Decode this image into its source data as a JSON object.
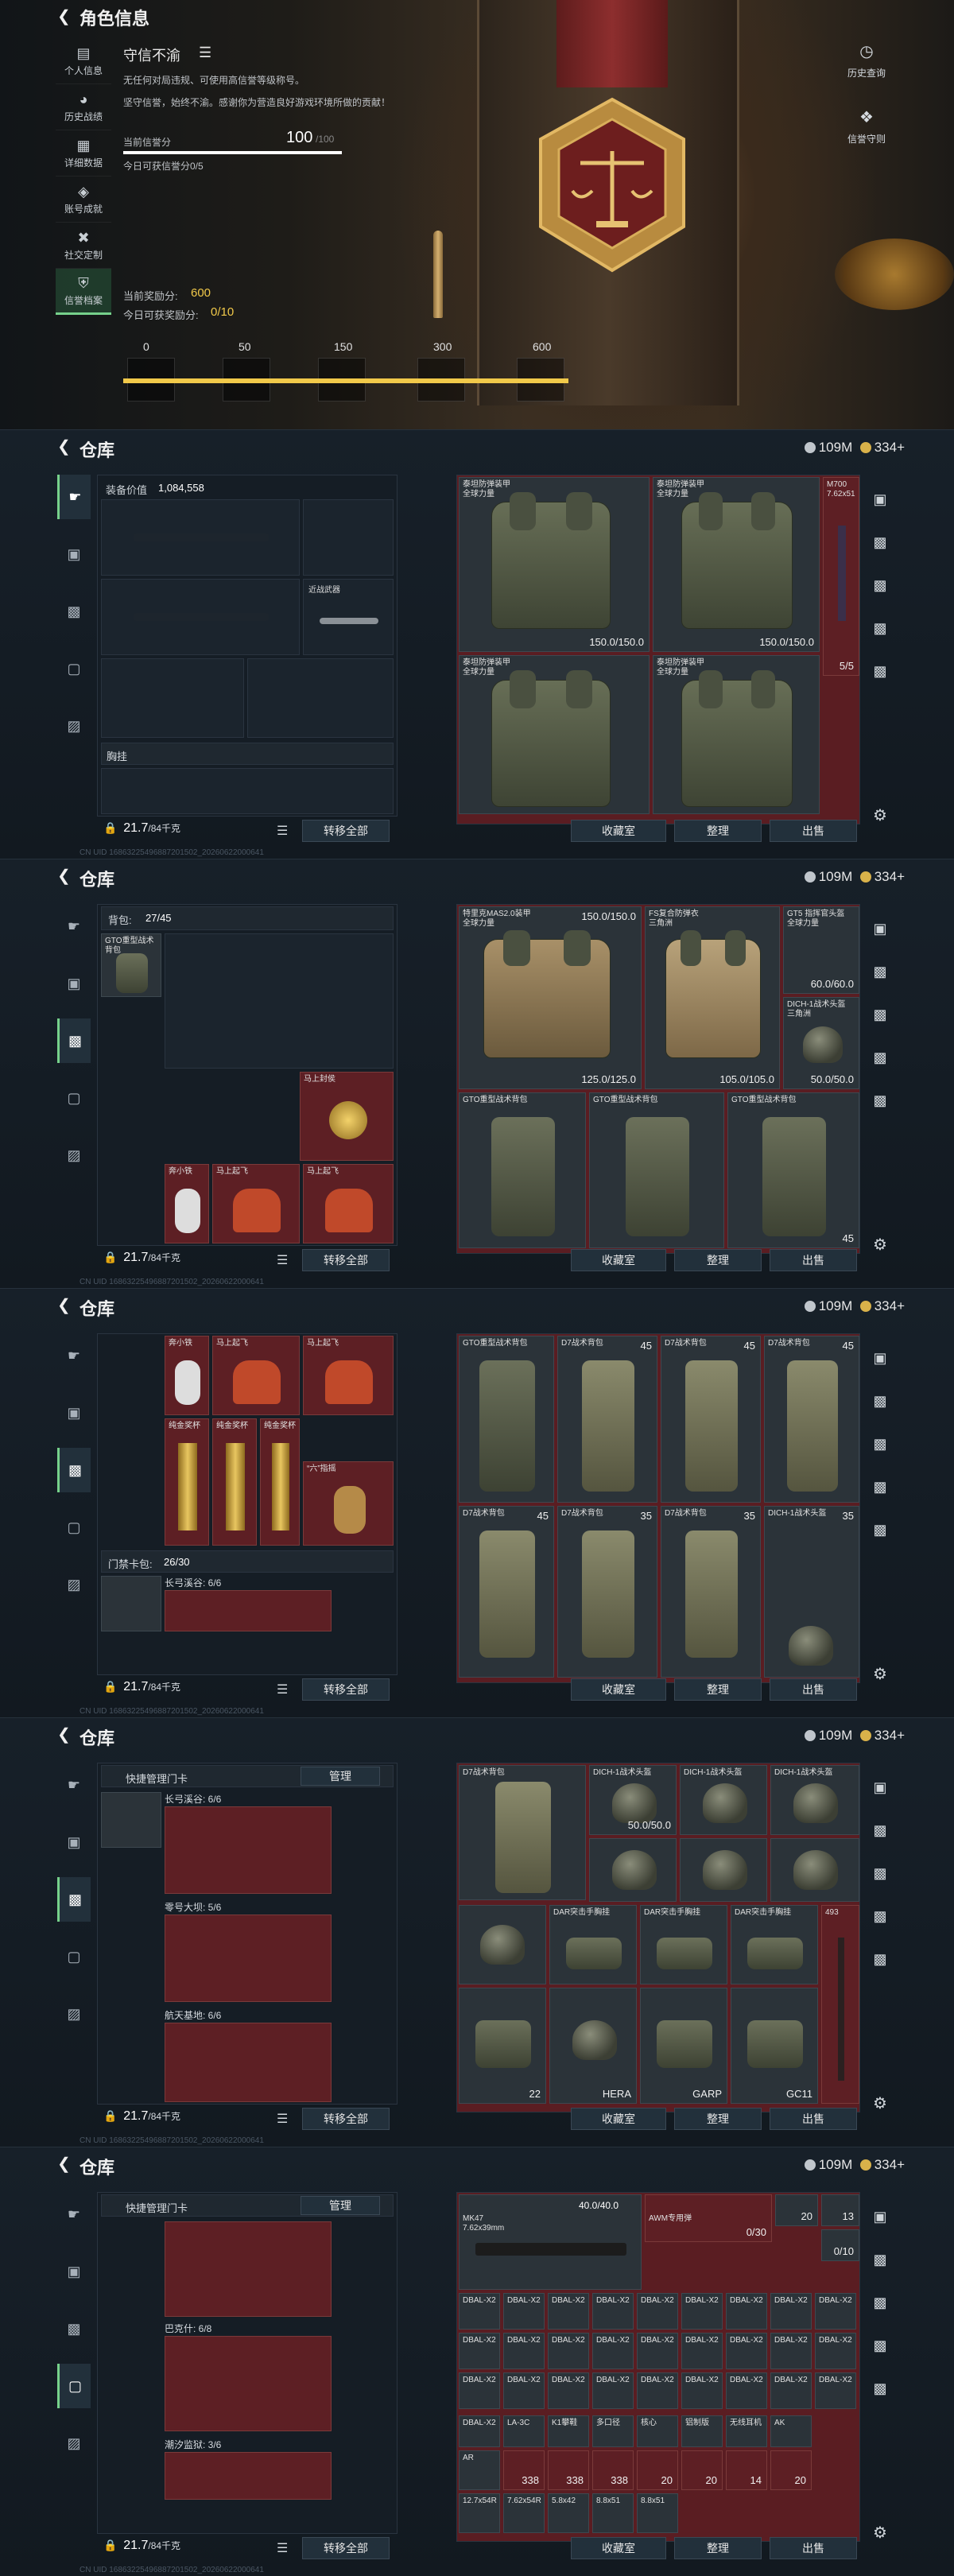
{
  "profile": {
    "title": "角色信息",
    "sidebar": [
      {
        "label": "个人信息",
        "icon": "chart-icon"
      },
      {
        "label": "历史战绩",
        "icon": "history-icon"
      },
      {
        "label": "详细数据",
        "icon": "data-icon"
      },
      {
        "label": "账号成就",
        "icon": "achievement-icon"
      },
      {
        "label": "社交定制",
        "icon": "tools-icon"
      },
      {
        "label": "信誉档案",
        "icon": "shield-icon"
      }
    ],
    "rep_title": "守信不渝",
    "rep_desc_1": "无任何对局违规、可使用高信誉等级称号。",
    "rep_desc_2": "坚守信誉，始终不渝。感谢你为营造良好游戏环境所做的贡献！",
    "rep_score_label": "当前信誉分",
    "rep_score": "100",
    "rep_score_max": "/100",
    "rep_today": "今日可获信誉分0/5",
    "reward_label": "当前奖励分:",
    "reward_value": "600",
    "reward_today_label": "今日可获奖励分:",
    "reward_today_value": "0/10",
    "tiers": [
      "0",
      "50",
      "150",
      "300",
      "600"
    ],
    "actions": [
      {
        "label": "历史查询",
        "icon": "clock-icon"
      },
      {
        "label": "信誉守则",
        "icon": "rules-icon"
      }
    ]
  },
  "warehouse": {
    "title": "仓库",
    "currency_silver": "109M",
    "currency_gold": "334+",
    "buttons": {
      "transfer_all": "转移全部",
      "collection": "收藏室",
      "tidy": "整理",
      "sell": "出售",
      "quick_manage": "管理"
    },
    "weight": "21.7",
    "weight_max": "/84千克",
    "uid": "CN UID 16863225496887201502_20260622000641"
  },
  "panel1": {
    "equip_value_label": "装备价值",
    "equip_value": "1,084,558",
    "chest_label": "胸挂",
    "bayonet_label": "近战武器",
    "items": [
      {
        "name": "泰坦防弹装甲",
        "sub": "全球力量",
        "val": "150.0/150.0"
      },
      {
        "name": "泰坦防弹装甲",
        "sub": "全球力量",
        "val": "150.0/150.0"
      },
      {
        "name": "泰坦防弹装甲",
        "sub": "全球力量",
        "val": ""
      },
      {
        "name": "泰坦防弹装甲",
        "sub": "全球力量",
        "val": ""
      }
    ],
    "side_item": "M700",
    "side_item_sub": "7.62x51",
    "ammo_count": "5/5"
  },
  "panel2": {
    "backpack_label": "背包:",
    "backpack_value": "27/45",
    "backpack_item": "GTO重型战术背包",
    "items": [
      {
        "name": "特里克MAS2.0装甲",
        "sub": "全球力量",
        "val": "150.0/150.0"
      },
      {
        "name": "FS复合防弹衣",
        "sub": "三角洲",
        "val": "150.0/150.0"
      },
      {
        "name": "GT5 指挥官头盔",
        "sub": "全球力量",
        "val": "60.0/60.0"
      },
      {
        "name": "DICH-1战术头盔",
        "sub": "三角洲",
        "val": "50.0/50.0"
      }
    ],
    "armor_vals": [
      "125.0/125.0",
      "105.0/105.0"
    ],
    "bag_names": [
      "GTO重型战术背包",
      "GTO重型战术背包",
      "GTO重型战术背包"
    ],
    "bag_count": "45",
    "bp_items": [
      "马上封侯",
      "奔小铁",
      "马上起飞",
      "马上起飞"
    ]
  },
  "panel3": {
    "card_label": "门禁卡包:",
    "card_value": "26/30",
    "card_row": "长弓溪谷: 6/6",
    "bp_items": [
      "奔小铁",
      "马上起飞",
      "马上起飞",
      "纯金奖杯",
      "纯金奖杯",
      "纯金奖杯",
      "“六”指摇"
    ],
    "pack_labels": [
      "GTO重型战术背包",
      "D7战术背包",
      "D7战术背包",
      "D7战术背包",
      "D7战术背包",
      "D7战术背包",
      "D7战术背包",
      "DICH-1战术头盔",
      "DICH-1战术头盔"
    ],
    "counts": [
      "45",
      "45",
      "45",
      "45",
      "35",
      "35",
      "35",
      "35"
    ]
  },
  "panel4": {
    "quick_card": "快捷管理门卡",
    "card_rows": [
      "长弓溪谷: 6/6",
      "零号大坝: 5/6",
      "航天基地: 6/6"
    ],
    "helmet_val": "50.0/50.0",
    "items": [
      "D7战术背包",
      "DICH-1战术头盔",
      "DICH-1战术头盔",
      "DICH-1战术头盔",
      "DAR突击手胸挂",
      "DAR突击手胸挂",
      "DAR突击手胸挂",
      "493"
    ],
    "bottom_counts": [
      "22",
      "HERA",
      "GARP",
      "GC11"
    ]
  },
  "panel5": {
    "quick_card": "快捷管理门卡",
    "card_rows": [
      "巴克什: 6/8",
      "潮汐监狱: 3/6"
    ],
    "gun_name": "MK47",
    "gun_caliber": "7.62x39mm",
    "ammo_label": "AWM专用弹",
    "ammo_val": "40.0/40.0",
    "mag_val": "0/10",
    "count_top": "20",
    "count_top2": "13",
    "mag_label": "0/30",
    "grid_label": "DBAL-X2",
    "misc": [
      "LA-3C",
      "K1攀鞋",
      "多口径",
      "核心",
      "铝制版",
      "无线耳机",
      "AK",
      "AR",
      "12.7x54R",
      "7.62x54R",
      "5.8x42",
      "8.8x51",
      "8.8x51"
    ],
    "ammo_counts": [
      "338",
      "338",
      "338",
      "20",
      "20",
      "14",
      "20"
    ]
  }
}
